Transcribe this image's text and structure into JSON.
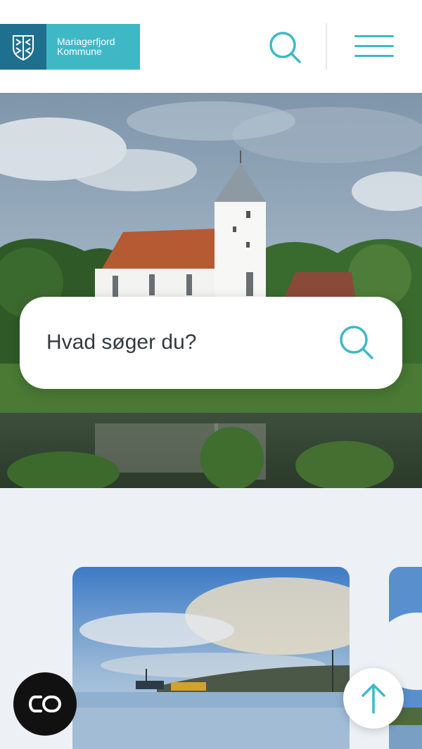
{
  "header": {
    "logo_line1": "Mariagerfjord",
    "logo_line2": "Kommune",
    "search_icon": "search-icon",
    "menu_icon": "hamburger-menu-icon"
  },
  "hero": {
    "image": "church-by-lake-photo",
    "search_placeholder": "Hvad søger du?"
  },
  "cards": [
    {
      "image": "harbor-landscape-photo"
    },
    {
      "image": "coast-landscape-photo"
    }
  ],
  "floating": {
    "chat_icon": "chat-widget-icon",
    "back_to_top_icon": "arrow-up-icon"
  },
  "colors": {
    "brand_teal": "#3fb8c6",
    "brand_dark": "#1f6f8e",
    "section_bg": "#edf1f5"
  }
}
